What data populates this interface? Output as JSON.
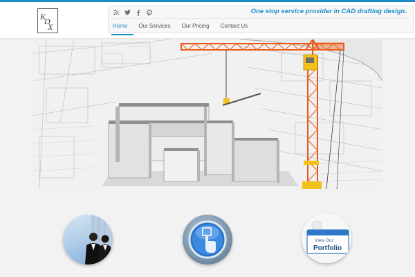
{
  "logo": {
    "text": "KDX"
  },
  "header": {
    "tagline": "One stop service provider in CAD drafting design.",
    "social_icons": [
      "rss-icon",
      "twitter-icon",
      "facebook-icon",
      "pinterest-icon"
    ]
  },
  "nav": {
    "items": [
      {
        "label": "Home",
        "active": true
      },
      {
        "label": "Our Services",
        "active": false
      },
      {
        "label": "Our Pricing",
        "active": false
      },
      {
        "label": "Contact Us",
        "active": false
      }
    ]
  },
  "features": {
    "portfolio_badge": {
      "line1": "View Our",
      "line2": "Portfolio"
    }
  },
  "colors": {
    "accent": "#1c8fc8",
    "crane": "#f26a21",
    "crane_cab": "#f2c21b"
  }
}
